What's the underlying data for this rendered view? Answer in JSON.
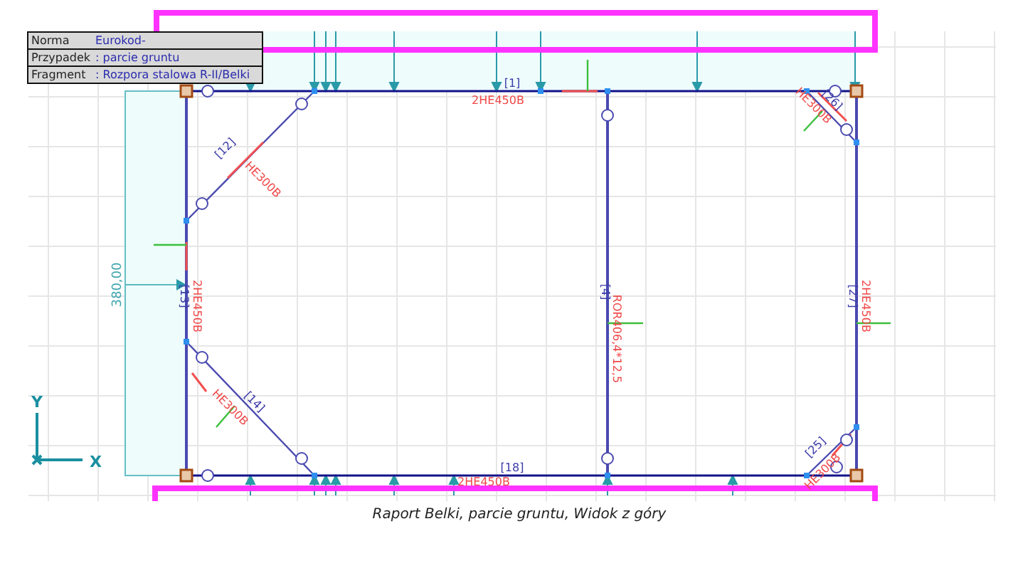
{
  "info_table": [
    {
      "label": "Norma",
      "value": "Eurokod-"
    },
    {
      "label": "Przypadek",
      "value": ": parcie gruntu"
    },
    {
      "label": "Fragment",
      "value": ": Rozpora stalowa R-II/Belki"
    }
  ],
  "members": [
    {
      "number": "[1]",
      "section": "2HE450B"
    },
    {
      "number": "[12]",
      "section": "HE300B"
    },
    {
      "number": "[13]",
      "section": "2HE450B"
    },
    {
      "number": "[14]",
      "section": "HE300B"
    },
    {
      "number": "[18]",
      "section": "2HE450B"
    },
    {
      "number": "[4]",
      "section": "ROR406,4*12,5"
    },
    {
      "number": "[27]",
      "section": "2HE450B"
    },
    {
      "number": "[26]",
      "section": "HE300B"
    },
    {
      "number": "[25]",
      "section": "HE300B"
    }
  ],
  "dimension": "380,00",
  "axes": {
    "y": "Y",
    "x": "X"
  },
  "caption": "Raport Belki, parcie gruntu, Widok z góry"
}
